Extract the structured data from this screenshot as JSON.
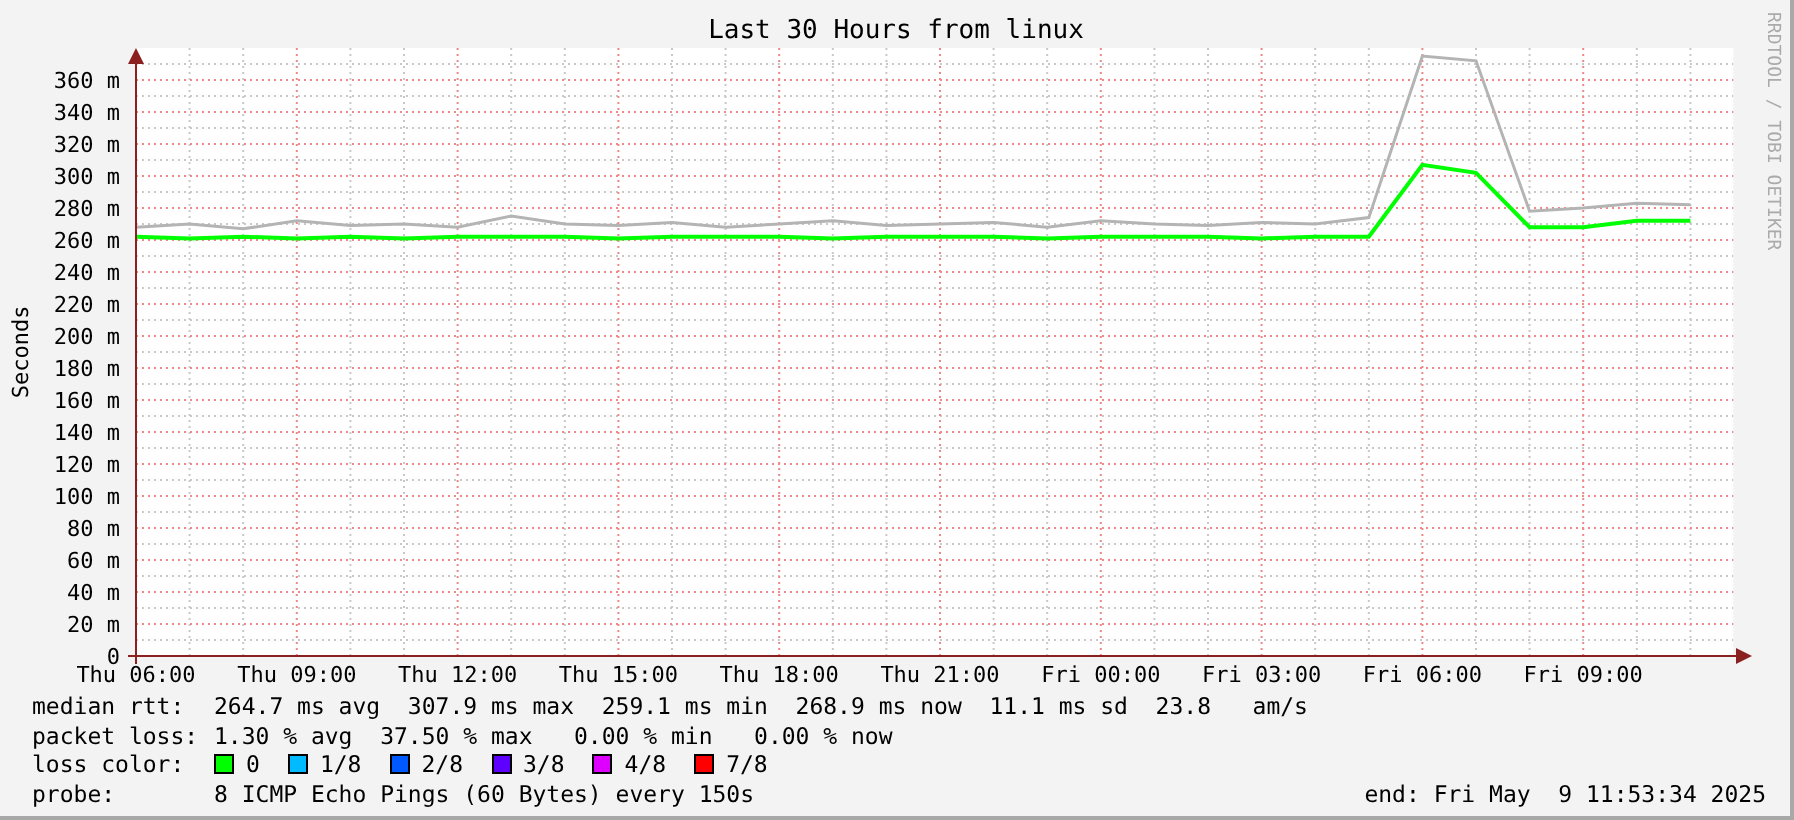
{
  "graph": {
    "credit": "RRDTOOL / TOBI OETIKER",
    "chart_data": {
      "type": "line",
      "title": "Last 30 Hours from linux",
      "ylabel": "Seconds",
      "categories": [
        "Thu 06:00",
        null,
        null,
        "Thu 09:00",
        null,
        null,
        "Thu 12:00",
        null,
        null,
        "Thu 15:00",
        null,
        null,
        "Thu 18:00",
        null,
        null,
        "Thu 21:00",
        null,
        null,
        "Fri 00:00",
        null,
        null,
        "Fri 03:00",
        null,
        null,
        "Fri 06:00",
        null,
        null,
        "Fri 09:00",
        null,
        null
      ],
      "series": [
        {
          "color": "#b4b4b4",
          "values": [
            268,
            270,
            267,
            272,
            269,
            270,
            268,
            275,
            270,
            269,
            271,
            268,
            270,
            272,
            269,
            270,
            271,
            268,
            272,
            270,
            269,
            271,
            270,
            274,
            375,
            372,
            278,
            280,
            283,
            282
          ]
        },
        {
          "color": "#00ff00",
          "values": [
            262,
            261,
            262,
            261,
            262,
            261,
            262,
            262,
            262,
            261,
            262,
            262,
            262,
            261,
            262,
            262,
            262,
            261,
            262,
            262,
            262,
            261,
            262,
            262,
            307,
            302,
            268,
            268,
            272,
            272
          ]
        }
      ],
      "ylim": [
        0,
        380
      ],
      "grid": true,
      "yticks": [
        {
          "value": 0,
          "label": "0"
        },
        {
          "value": 20,
          "label": "20 m"
        },
        {
          "value": 40,
          "label": "40 m"
        },
        {
          "value": 60,
          "label": "60 m"
        },
        {
          "value": 80,
          "label": "80 m"
        },
        {
          "value": 100,
          "label": "100 m"
        },
        {
          "value": 120,
          "label": "120 m"
        },
        {
          "value": 140,
          "label": "140 m"
        },
        {
          "value": 160,
          "label": "160 m"
        },
        {
          "value": 180,
          "label": "180 m"
        },
        {
          "value": 200,
          "label": "200 m"
        },
        {
          "value": 220,
          "label": "220 m"
        },
        {
          "value": 240,
          "label": "240 m"
        },
        {
          "value": 260,
          "label": "260 m"
        },
        {
          "value": 280,
          "label": "280 m"
        },
        {
          "value": 300,
          "label": "300 m"
        },
        {
          "value": 320,
          "label": "320 m"
        },
        {
          "value": 340,
          "label": "340 m"
        },
        {
          "value": 360,
          "label": "360 m"
        }
      ]
    }
  },
  "legend": [
    {
      "label": "median rtt:",
      "text": "264.7 ms avg  307.9 ms max  259.1 ms min  268.9 ms now  11.1 ms sd  23.8   am/s"
    },
    {
      "label": "packet loss:",
      "text": "1.30 % avg  37.50 % max   0.00 % min   0.00 % now"
    }
  ],
  "loss_colors": {
    "label": "loss color:",
    "items": [
      {
        "label": "0",
        "color": "#00ff00"
      },
      {
        "label": "1/8",
        "color": "#00bbff"
      },
      {
        "label": "2/8",
        "color": "#0059ff"
      },
      {
        "label": "3/8",
        "color": "#5e00ff"
      },
      {
        "label": "4/8",
        "color": "#dd00ff"
      },
      {
        "label": "7/8",
        "color": "#ff0000"
      }
    ]
  },
  "probe": {
    "label": "probe:",
    "text": "8 ICMP Echo Pings (60 Bytes) every 150s",
    "end": "end: Fri May  9 11:53:34 2025"
  }
}
